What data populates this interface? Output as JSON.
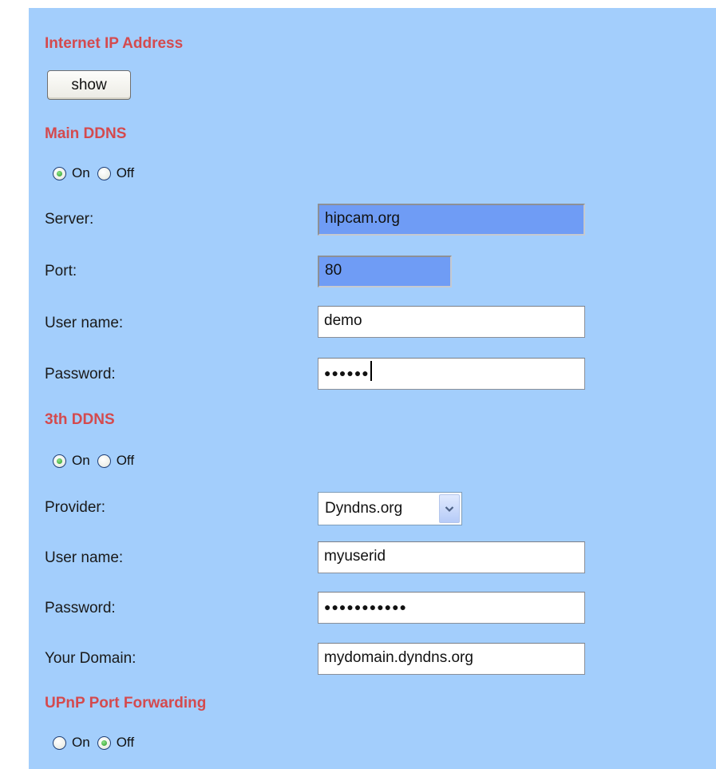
{
  "sections": {
    "internet_ip": {
      "title": "Internet IP Address",
      "show_button": "show"
    },
    "main_ddns": {
      "title": "Main DDNS",
      "on_label": "On",
      "off_label": "Off",
      "selected": "On",
      "server_label": "Server:",
      "server_value": "hipcam.org",
      "port_label": "Port:",
      "port_value": "80",
      "username_label": "User name:",
      "username_value": "demo",
      "password_label": "Password:",
      "password_mask": "●●●●●●"
    },
    "third_ddns": {
      "title": "3th DDNS",
      "on_label": "On",
      "off_label": "Off",
      "selected": "On",
      "provider_label": "Provider:",
      "provider_value": "Dyndns.org",
      "username_label": "User name:",
      "username_value": "myuserid",
      "password_label": "Password:",
      "password_mask": "●●●●●●●●●●●",
      "domain_label": "Your Domain:",
      "domain_value": "mydomain.dyndns.org"
    },
    "upnp": {
      "title": "UPnP Port Forwarding",
      "on_label": "On",
      "off_label": "Off",
      "selected": "Off"
    }
  },
  "colors": {
    "panel_bg": "#a3cefc",
    "section_title": "#d44a4e",
    "highlight_field": "#6f9cf5"
  }
}
